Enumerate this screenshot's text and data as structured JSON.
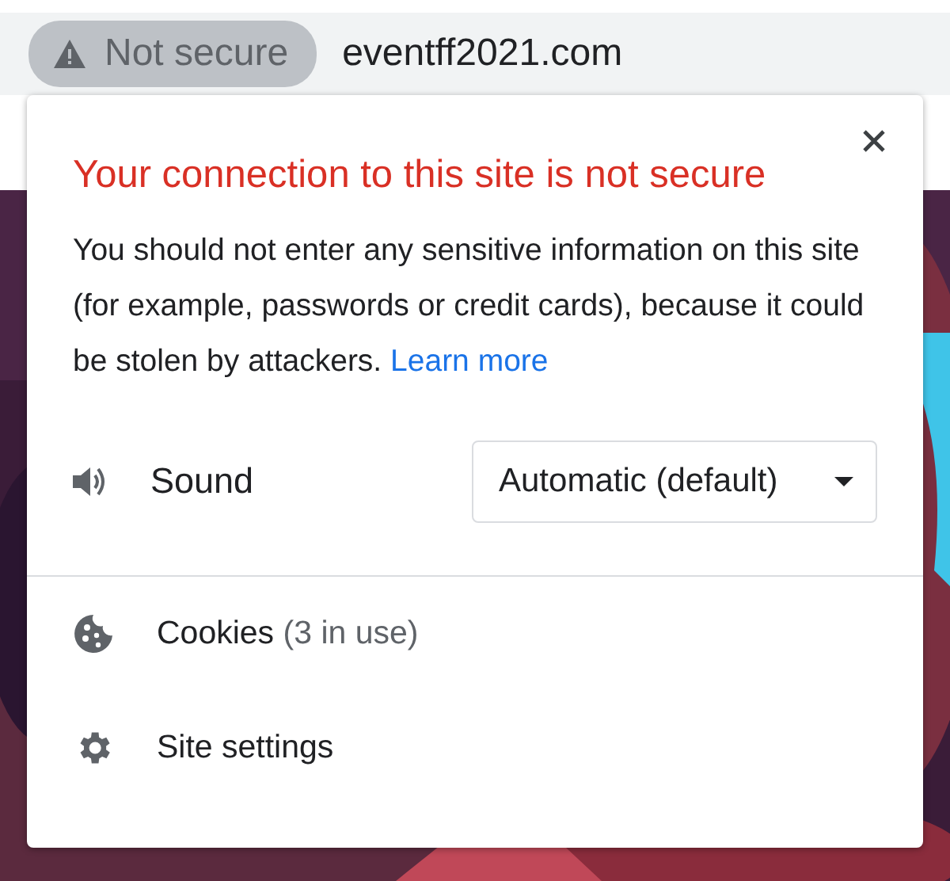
{
  "address_bar": {
    "security_chip": {
      "label": "Not secure"
    },
    "url": "eventff2021.com"
  },
  "popup": {
    "title": "Your connection to this site is not secure",
    "message": "You should not enter any sensitive information on this site (for example, passwords or credit cards), because it could be stolen by attackers.",
    "learn_more": "Learn more",
    "permissions": [
      {
        "label": "Sound",
        "value": "Automatic (default)"
      }
    ],
    "items": [
      {
        "kind": "cookies",
        "label": "Cookies",
        "detail": "(3 in use)"
      },
      {
        "kind": "settings",
        "label": "Site settings"
      }
    ]
  }
}
